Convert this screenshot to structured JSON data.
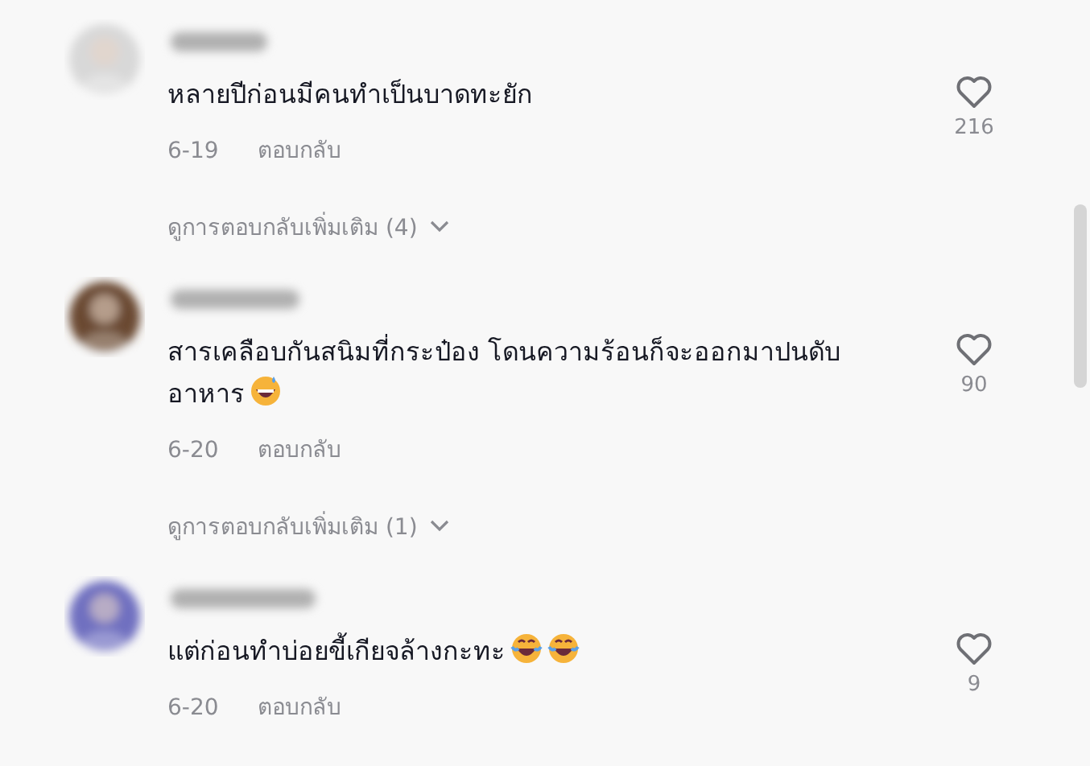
{
  "comments": [
    {
      "text": "หลายปีก่อนมีคนทำเป็นบาดทะยัก",
      "date": "6-19",
      "reply": "ตอบกลับ",
      "likes": "216",
      "more_replies": "ดูการตอบกลับเพิ่มเติม (4)"
    },
    {
      "text": "สารเคลือบกันสนิมที่กระป๋อง โดนความร้อนก็จะออกมาปนดับอาหาร",
      "emojis": [
        {
          "kind": "grin-sweat"
        }
      ],
      "date": "6-20",
      "reply": "ตอบกลับ",
      "likes": "90",
      "more_replies": "ดูการตอบกลับเพิ่มเติม (1)"
    },
    {
      "text": "แต่ก่อนทำบ่อยขี้เกียจล้างกะทะ",
      "emojis": [
        {
          "kind": "tears-of-joy"
        },
        {
          "kind": "tears-of-joy"
        }
      ],
      "date": "6-20",
      "reply": "ตอบกลับ",
      "likes": "9"
    }
  ]
}
